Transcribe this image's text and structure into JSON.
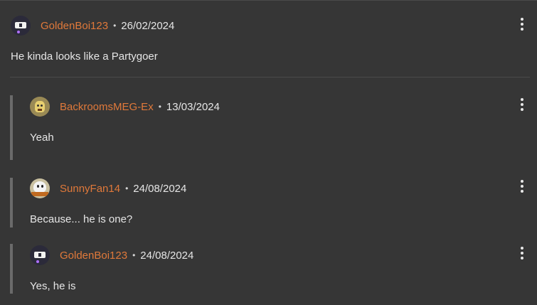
{
  "comments": [
    {
      "username": "GoldenBoi123",
      "date": "26/02/2024",
      "text": "He kinda looks like a Partygoer",
      "avatar": "goldenboi-avatar"
    }
  ],
  "replies": [
    {
      "username": "BackroomsMEG-Ex",
      "date": "13/03/2024",
      "text": "Yeah",
      "avatar": "meg-avatar"
    },
    {
      "username": "SunnyFan14",
      "date": "24/08/2024",
      "text": "Because... he is one?",
      "avatar": "sunny-avatar"
    },
    {
      "username": "GoldenBoi123",
      "date": "24/08/2024",
      "text": "Yes, he is",
      "avatar": "goldenboi-avatar"
    }
  ],
  "separator": "•",
  "colors": {
    "background": "#363636",
    "username": "#e0793a",
    "text": "#e6e6e6",
    "reply_bar": "#6a6a6a"
  },
  "icons": {
    "menu": "more-vertical-icon"
  }
}
